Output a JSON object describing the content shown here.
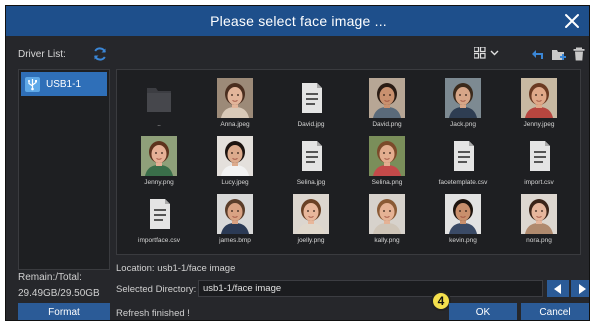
{
  "dialog": {
    "title": "Please select face image ...",
    "driver_list_label": "Driver List:",
    "drive": "USB1-1",
    "remain_label": "Remain:/Total:",
    "remain_value": "29.49GB/29.50GB",
    "format_label": "Format",
    "location": "Location: usb1-1/face image",
    "selected_directory_label": "Selected Directory:",
    "selected_directory_value": "usb1-1/face image",
    "status": "Refresh finished !",
    "ok_label": "OK",
    "cancel_label": "Cancel",
    "step_badge": "4"
  },
  "files": [
    {
      "name": "..",
      "type": "folder"
    },
    {
      "name": "Anna.jpeg",
      "type": "photo",
      "bg": "#9c8a78",
      "skin": "#e2b59a",
      "hair": "#4a2e1f",
      "shirt": "#d9c9b8"
    },
    {
      "name": "David.jpg",
      "type": "doc"
    },
    {
      "name": "David.png",
      "type": "photo",
      "bg": "#b7a695",
      "skin": "#c9916f",
      "hair": "#2a1c14",
      "shirt": "#5a6a7a"
    },
    {
      "name": "Jack.png",
      "type": "photo",
      "bg": "#7d8a92",
      "skin": "#d7a688",
      "hair": "#3b2a1c",
      "shirt": "#2e3d52"
    },
    {
      "name": "Jenny.jpeg",
      "type": "photo",
      "bg": "#c8b9a2",
      "skin": "#e0a989",
      "hair": "#6b3a22",
      "shirt": "#b7463f"
    },
    {
      "name": "Jenny.png",
      "type": "photo",
      "bg": "#8fa07a",
      "skin": "#e6b096",
      "hair": "#5d321d",
      "shirt": "#3a6e4a"
    },
    {
      "name": "Lucy.jpeg",
      "type": "photo",
      "bg": "#e4e0dc",
      "skin": "#dcaa8c",
      "hair": "#1d1410",
      "shirt": "#f2f2f2"
    },
    {
      "name": "Selina.jpg",
      "type": "doc"
    },
    {
      "name": "Selina.png",
      "type": "photo",
      "bg": "#7a8e5a",
      "skin": "#e3ad8f",
      "hair": "#7c4a2a",
      "shirt": "#c44a4a"
    },
    {
      "name": "facetemplate.csv",
      "type": "doc"
    },
    {
      "name": "import.csv",
      "type": "doc"
    },
    {
      "name": "importface.csv",
      "type": "doc"
    },
    {
      "name": "james.bmp",
      "type": "photo",
      "bg": "#d8d8d8",
      "skin": "#d9a283",
      "hair": "#5a3d2a",
      "shirt": "#2b3a55"
    },
    {
      "name": "joelly.png",
      "type": "photo",
      "bg": "#dcd6cf",
      "skin": "#e8b79b",
      "hair": "#6a4125",
      "shirt": "#e0d8cc"
    },
    {
      "name": "kally.png",
      "type": "photo",
      "bg": "#d7d2cc",
      "skin": "#e5b295",
      "hair": "#8a5a35",
      "shirt": "#cfc5b8"
    },
    {
      "name": "kevin.png",
      "type": "photo",
      "bg": "#e2e2e2",
      "skin": "#c98f6c",
      "hair": "#1e140e",
      "shirt": "#3a4a66"
    },
    {
      "name": "nora.png",
      "type": "photo",
      "bg": "#ddd7d0",
      "skin": "#e6b69c",
      "hair": "#3b2418",
      "shirt": "#b08a6e"
    }
  ],
  "colors": {
    "title_bar": "#1e4f8b",
    "accent": "#2b5b97",
    "selected_drive": "#2f6fb8",
    "panel": "#1e1f22",
    "background": "#26272b",
    "badge": "#f4e04d"
  },
  "icons": {
    "close": "close-icon",
    "refresh": "refresh-icon",
    "usb": "usb-icon",
    "view": "grid-view-icon",
    "back": "back-arrow-icon",
    "new_folder": "new-folder-icon",
    "delete": "trash-icon",
    "prev": "triangle-left-icon",
    "next": "triangle-right-icon"
  }
}
